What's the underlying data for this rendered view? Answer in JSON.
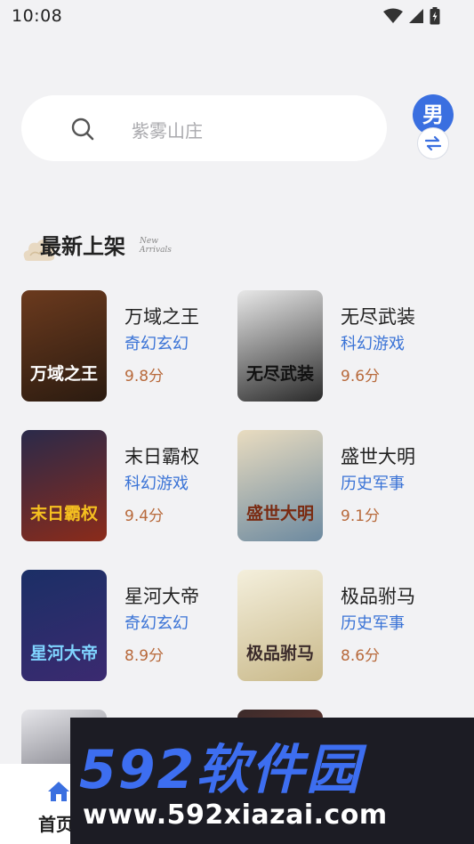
{
  "status_bar": {
    "time": "10:08"
  },
  "search": {
    "placeholder": "紫雾山庄"
  },
  "gender": {
    "label": "男"
  },
  "section": {
    "title": "最新上架",
    "subtitle_line1": "New",
    "subtitle_line2": "Arrivals"
  },
  "books": [
    {
      "name": "万域之王",
      "category": "奇幻玄幻",
      "score": "9.8分",
      "cover_text": "万域之王",
      "cover_colors": [
        "#6b3a1e",
        "#2b1b10"
      ],
      "cover_text_color": "#ffffff"
    },
    {
      "name": "无尽武装",
      "category": "科幻游戏",
      "score": "9.6分",
      "cover_text": "无尽武装",
      "cover_colors": [
        "#e8e8e8",
        "#2a2a2a"
      ],
      "cover_text_color": "#111111"
    },
    {
      "name": "末日霸权",
      "category": "科幻游戏",
      "score": "9.4分",
      "cover_text": "末日霸权",
      "cover_colors": [
        "#2a2a4a",
        "#8b2b1a"
      ],
      "cover_text_color": "#f5c020"
    },
    {
      "name": "盛世大明",
      "category": "历史军事",
      "score": "9.1分",
      "cover_text": "盛世大明",
      "cover_colors": [
        "#e9dcc0",
        "#6d8aa0"
      ],
      "cover_text_color": "#7a2b12"
    },
    {
      "name": "星河大帝",
      "category": "奇幻玄幻",
      "score": "8.9分",
      "cover_text": "星河大帝",
      "cover_colors": [
        "#1b2f66",
        "#3b2a70"
      ],
      "cover_text_color": "#7fd4ff"
    },
    {
      "name": "极品驸马",
      "category": "历史军事",
      "score": "8.6分",
      "cover_text": "极品驸马",
      "cover_colors": [
        "#f4efdc",
        "#c9b98a"
      ],
      "cover_text_color": "#3a2a2a"
    }
  ],
  "partial_covers": [
    {
      "cover_colors": [
        "#e6e6ea",
        "#4a4a55"
      ]
    },
    {
      "cover_colors": [
        "#3a2a2a",
        "#a04a3a"
      ]
    }
  ],
  "bottom_nav": {
    "home_label": "首页"
  },
  "watermark": {
    "logo": "592软件园",
    "url": "www.592xiazai.com"
  },
  "colors": {
    "accent": "#3a73d6",
    "score": "#b86a3c",
    "gender_badge": "#3a6fe0"
  }
}
